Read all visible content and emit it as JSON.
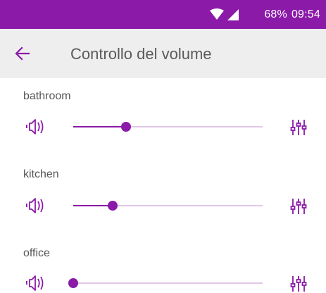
{
  "status_bar": {
    "battery": "68%",
    "time": "09:54",
    "icons": [
      "wifi-icon",
      "signal-icon"
    ],
    "background": "#8b1aa8"
  },
  "app_bar": {
    "title": "Controllo del volume",
    "back_icon": "arrow-left-icon"
  },
  "accent_color": "#8b1aa8",
  "rooms": [
    {
      "label": "bathroom",
      "volume": 0.28,
      "speaker_icon": "speaker-icon",
      "settings_icon": "equalizer-icon"
    },
    {
      "label": "kitchen",
      "volume": 0.21,
      "speaker_icon": "speaker-icon",
      "settings_icon": "equalizer-icon"
    },
    {
      "label": "office",
      "volume": 0.0,
      "speaker_icon": "speaker-icon",
      "settings_icon": "equalizer-icon"
    }
  ]
}
